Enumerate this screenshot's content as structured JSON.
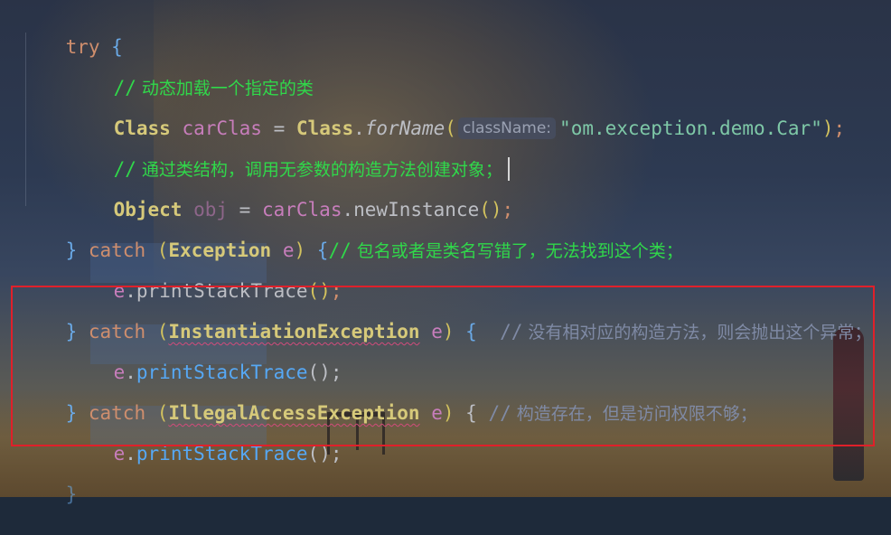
{
  "code": {
    "l1": {
      "kw": "try",
      "brace": " {"
    },
    "l2": {
      "slash": "//",
      "text": " 动态加载一个指定的类"
    },
    "l3": {
      "type": "Class",
      "var": "carClas",
      "eq": " = ",
      "cls": "Class",
      "dot": ".",
      "method": "forName",
      "lp": "(",
      "hint": "className:",
      "str": "\"om.exception.demo.Car\"",
      "rp": ")",
      "semi": ";"
    },
    "l4": {
      "slash": "//",
      "text": " 通过类结构，调用无参数的构造方法创建对象；"
    },
    "l5": {
      "type": "Object",
      "var": "obj",
      "eq": " = ",
      "obj": "carClas",
      "dot": ".",
      "method": "newInstance",
      "parens": "()",
      "semi": ";"
    },
    "l6": {
      "rb": "} ",
      "kw": "catch",
      "lp": " (",
      "exc": "Exception",
      "var": " e",
      "rp": ")",
      "lb": " {",
      "slash": "//",
      "text": " 包名或者是类名写错了，无法找到这个类；"
    },
    "l7": {
      "var": "e",
      "dot": ".",
      "method": "printStackTrace",
      "parens": "()",
      "semi": ";"
    },
    "l8": {
      "rb": "} ",
      "kw": "catch",
      "lp": " (",
      "exc": "InstantiationException",
      "var": " e",
      "rp": ")",
      "lb": " {",
      "slash": "//",
      "text": " 没有相对应的构造方法，则会抛出这个异常；"
    },
    "l9": {
      "var": "e",
      "dot": ".",
      "method": "printStackTrace",
      "parens": "()",
      "semi": ";"
    },
    "l10": {
      "rb": "} ",
      "kw": "catch",
      "lp": " (",
      "exc": "IllegalAccessException",
      "var": " e",
      "rp": ")",
      "lb": " {",
      "slash": "//",
      "text": " 构造存在，但是访问权限不够；"
    },
    "l11": {
      "var": "e",
      "dot": ".",
      "method": "printStackTrace",
      "parens": "()",
      "semi": ";"
    },
    "l12": {
      "rb": "}"
    }
  },
  "colors": {
    "highlight_box": "#e0202a",
    "green_comment": "#30d84a",
    "dim_comment": "#7f8aa5"
  }
}
